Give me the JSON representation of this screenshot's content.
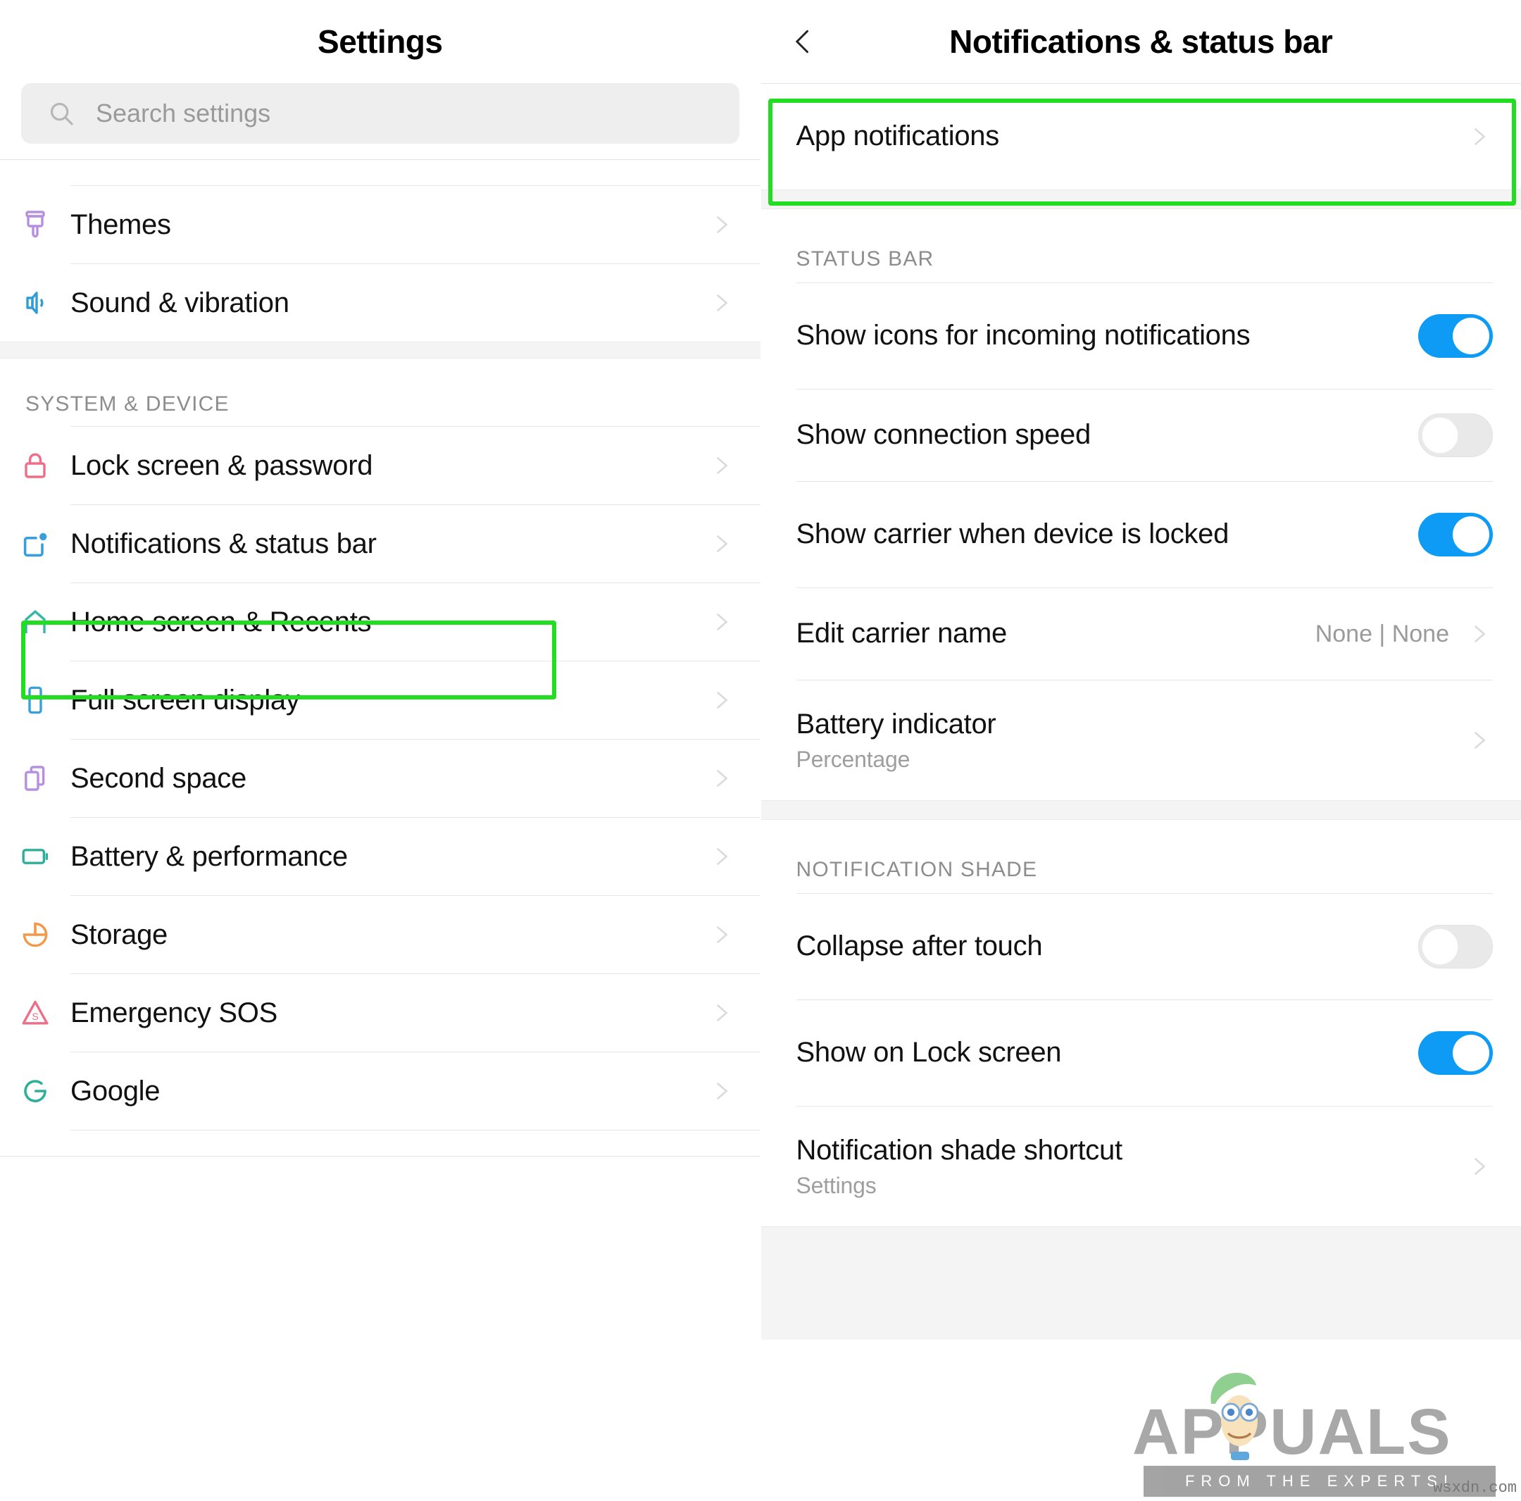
{
  "left_panel": {
    "title": "Settings",
    "search": {
      "placeholder": "Search settings",
      "icon": "search-icon"
    },
    "sections": [
      {
        "header": "",
        "items": [
          {
            "label": "Themes",
            "icon": "paintbrush-icon",
            "color": "#b78fe0",
            "chevron": true
          },
          {
            "label": "Sound & vibration",
            "icon": "speaker-icon",
            "color": "#2e9fd6",
            "chevron": true
          }
        ]
      },
      {
        "header": "SYSTEM & DEVICE",
        "items": [
          {
            "label": "Lock screen & password",
            "icon": "lock-icon",
            "color": "#ef6e87",
            "chevron": true
          },
          {
            "label": "Notifications & status bar",
            "icon": "notification-badge-icon",
            "color": "#3a9fd8",
            "chevron": true,
            "highlighted": true
          },
          {
            "label": "Home screen & Recents",
            "icon": "home-icon",
            "color": "#34b6a8",
            "chevron": true
          },
          {
            "label": "Full screen display",
            "icon": "phone-icon",
            "color": "#3a9fd8",
            "chevron": true
          },
          {
            "label": "Second space",
            "icon": "copy-icon",
            "color": "#b78fe0",
            "chevron": true
          },
          {
            "label": "Battery & performance",
            "icon": "battery-icon",
            "color": "#2eaf9b",
            "chevron": true
          },
          {
            "label": "Storage",
            "icon": "pie-chart-icon",
            "color": "#f2994a",
            "chevron": true
          },
          {
            "label": "Emergency SOS",
            "icon": "sos-triangle-icon",
            "color": "#ef6e87",
            "chevron": true
          },
          {
            "label": "Google",
            "icon": "google-g-icon",
            "color": "#2eaf9b",
            "chevron": true
          }
        ]
      }
    ]
  },
  "right_panel": {
    "back_icon": "chevron-left-icon",
    "title": "Notifications & status bar",
    "app_notifications": {
      "label": "App notifications",
      "chevron": true,
      "highlighted": true
    },
    "sections": [
      {
        "header": "STATUS BAR",
        "rows": [
          {
            "label": "Show icons for incoming notifications",
            "control": "toggle",
            "value": "on"
          },
          {
            "label": "Show connection speed",
            "control": "toggle",
            "value": "off"
          },
          {
            "label": "Show carrier when device is locked",
            "control": "toggle",
            "value": "on"
          },
          {
            "label": "Edit carrier name",
            "control": "value",
            "value": "None | None",
            "chevron": true
          },
          {
            "label": "Battery indicator",
            "sub": "Percentage",
            "control": "chevron",
            "chevron": true
          }
        ]
      },
      {
        "header": "NOTIFICATION SHADE",
        "rows": [
          {
            "label": "Collapse after touch",
            "control": "toggle",
            "value": "off"
          },
          {
            "label": "Show on Lock screen",
            "control": "toggle",
            "value": "on"
          },
          {
            "label": "Notification shade shortcut",
            "sub": "Settings",
            "control": "chevron",
            "chevron": true
          }
        ]
      }
    ]
  },
  "watermark": {
    "brand": "APPUALS",
    "tagline": "FROM THE EXPERTS!",
    "source": "wsxdn.com"
  },
  "colors": {
    "highlight": "#22dd22",
    "toggle_on": "#0d9bf5",
    "toggle_off": "#e9e9e9",
    "text_primary": "#111111",
    "text_secondary": "#9a9a9a",
    "section_header": "#8d8d8d"
  }
}
